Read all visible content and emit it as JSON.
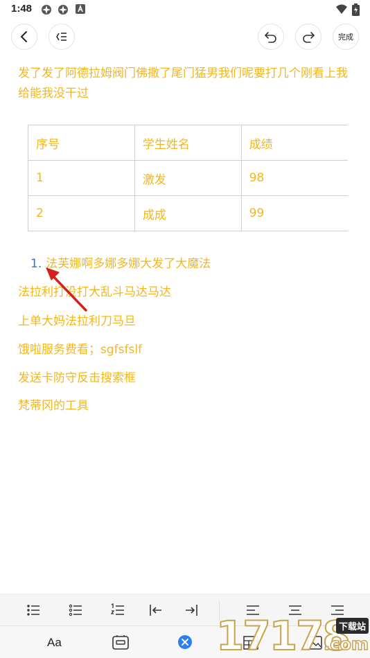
{
  "status_bar": {
    "time": "1:48",
    "left_icons": [
      "cog-notification-icon",
      "cog-notification-icon",
      "a-box-icon"
    ],
    "right_icons": [
      "wifi-icon",
      "battery-icon"
    ]
  },
  "top_bar": {
    "back_icon": "chevron-left-icon",
    "outline_icon": "outline-list-icon",
    "undo_icon": "undo-icon",
    "redo_icon": "redo-icon",
    "done_label": "完成"
  },
  "document": {
    "paragraph": "发了发了阿德拉姆阀门佛撒了尾门猛男我们呢要打几个刚看上我给能我没干过",
    "table": {
      "headers": [
        "序号",
        "学生姓名",
        "成绩"
      ],
      "rows": [
        [
          "1",
          "激发",
          "98"
        ],
        [
          "2",
          "成成",
          "99"
        ]
      ]
    },
    "ordered_list": [
      {
        "number": "1.",
        "text": "法芙娜啊多娜多娜大发了大魔法"
      }
    ],
    "lines": [
      "法拉利打没打大乱斗马达马达",
      "上单大妈法拉利刀马旦",
      "饿啦服务费看；sgfsfslf",
      "发送卡防守反击搜索框",
      "梵蒂冈的工具"
    ]
  },
  "toolbar_format": {
    "items": [
      "bullet-list-icon",
      "dotted-list-icon",
      "numbered-list-icon",
      "outdent-icon",
      "indent-icon",
      "align-left-icon",
      "align-center-icon",
      "align-right-icon"
    ]
  },
  "toolbar_bottom": {
    "font_label": "Aa",
    "items": [
      "card-icon",
      "close-circle-icon",
      "table-icon",
      "image-icon"
    ]
  },
  "watermark": {
    "digits": "17178",
    "badge": "下载站",
    "suffix": ".com"
  },
  "colors": {
    "text_accent": "#f3b71b",
    "list_number": "#2f74d0",
    "arrow": "#d32020",
    "close_button": "#2d7ff0"
  }
}
